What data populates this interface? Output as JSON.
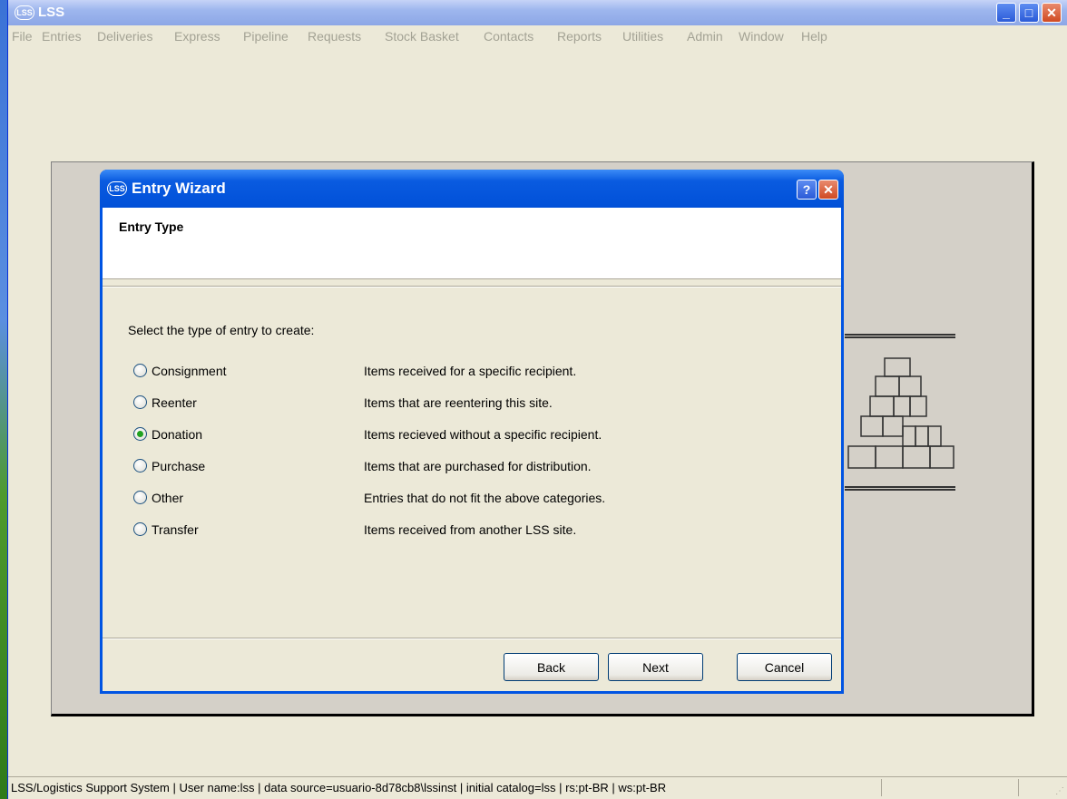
{
  "app": {
    "icon_text": "LSS",
    "title": "LSS",
    "window_buttons": {
      "minimize": "_",
      "maximize": "□",
      "close": "✕"
    }
  },
  "menu": [
    "File",
    "Entries",
    "Deliveries",
    "Express",
    "Pipeline",
    "Requests",
    "Stock Basket",
    "Contacts",
    "Reports",
    "Utilities",
    "Admin",
    "Window",
    "Help"
  ],
  "dialog": {
    "icon_text": "LSS",
    "title": "Entry Wizard",
    "help_button": "?",
    "close_button": "✕",
    "header_title": "Entry Type",
    "prompt": "Select the type of entry to create:",
    "options": [
      {
        "label": "Consignment",
        "description": "Items received for a specific recipient.",
        "selected": false
      },
      {
        "label": "Reenter",
        "description": "Items that are reentering this site.",
        "selected": false
      },
      {
        "label": "Donation",
        "description": "Items recieved without a specific recipient.",
        "selected": true
      },
      {
        "label": "Purchase",
        "description": "Items that are purchased for distribution.",
        "selected": false
      },
      {
        "label": "Other",
        "description": "Entries that do not fit the above categories.",
        "selected": false
      },
      {
        "label": "Transfer",
        "description": "Items received from another LSS site.",
        "selected": false
      }
    ],
    "buttons": {
      "back": "Back",
      "next": "Next",
      "cancel": "Cancel"
    }
  },
  "statusbar": {
    "text": "LSS/Logistics Support System | User name:lss | data source=usuario-8d78cb8\\lssinst | initial catalog=lss | rs:pt-BR | ws:pt-BR"
  },
  "colors": {
    "titlebar": "#0054e3",
    "window_bg": "#ece9d8",
    "radio_selected": "#21a121"
  }
}
